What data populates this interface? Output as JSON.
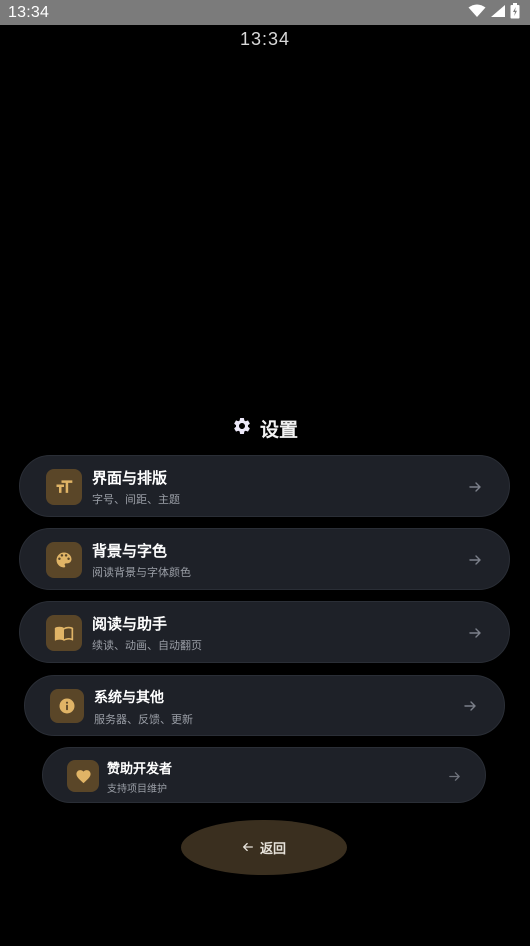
{
  "status_bar": {
    "time": "13:34",
    "icons": [
      "wifi-icon",
      "signal-icon",
      "battery-icon"
    ]
  },
  "clock": "13:34",
  "settings": {
    "title": "设置",
    "icon": "gear-icon",
    "items": [
      {
        "title": "界面与排版",
        "subtitle": "字号、间距、主题",
        "icon": "text-size-icon"
      },
      {
        "title": "背景与字色",
        "subtitle": "阅读背景与字体颜色",
        "icon": "palette-icon"
      },
      {
        "title": "阅读与助手",
        "subtitle": "续读、动画、自动翻页",
        "icon": "book-icon"
      },
      {
        "title": "系统与其他",
        "subtitle": "服务器、反馈、更新",
        "icon": "info-icon"
      },
      {
        "title": "赞助开发者",
        "subtitle": "支持项目维护",
        "icon": "heart-icon"
      }
    ]
  },
  "back_button": {
    "label": "返回",
    "icon": "arrow-left-icon"
  },
  "colors": {
    "background": "#000000",
    "status_bar": "#7b7b7b",
    "card": "#1e2128",
    "icon_bg": "#5a4628",
    "accent_gold": "#e0b466",
    "back_button": "#3a2f1f"
  }
}
